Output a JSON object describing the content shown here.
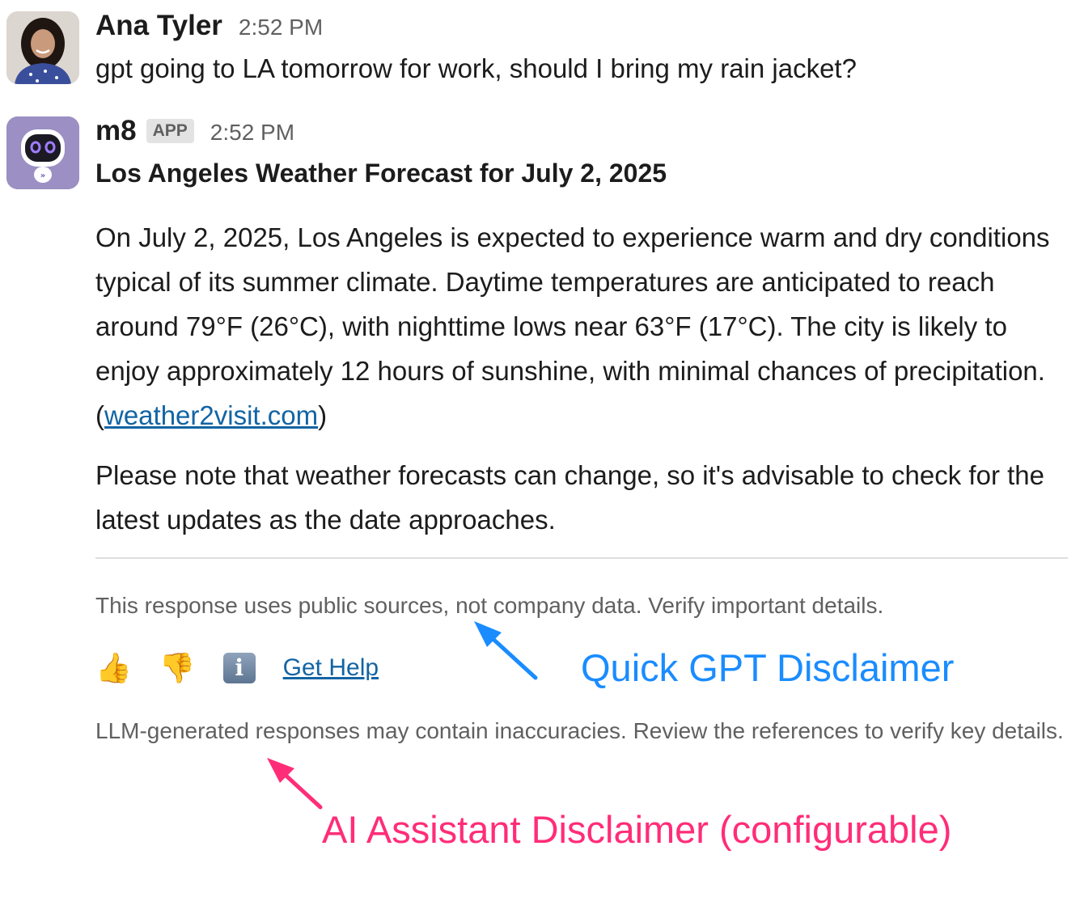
{
  "messages": [
    {
      "sender": "Ana Tyler",
      "time": "2:52 PM",
      "text": "gpt going to LA tomorrow for work, should I bring my rain jacket?",
      "avatar_icon": "user-photo-avatar"
    },
    {
      "sender": "m8",
      "badge": "APP",
      "time": "2:52 PM",
      "avatar_icon": "robot-avatar",
      "title": "Los Angeles Weather Forecast for July 2, 2025",
      "paragraph1": "On July 2, 2025, Los Angeles is expected to experience warm and dry conditions typical of its summer climate. Daytime temperatures are anticipated to reach around 79°F (26°C), with nighttime lows near 63°F (17°C). The city is likely to enjoy approximately 12 hours of sunshine, with minimal chances of precipitation. (",
      "link_text": "weather2visit.com",
      "paragraph1_end": ")",
      "paragraph2": "Please note that weather forecasts can change, so it's advisable to check for the latest updates as the date approaches.",
      "notice": "This response uses public sources, not company data. Verify important details.",
      "actions": {
        "thumbs_up": "👍",
        "thumbs_down": "👎",
        "info": "i",
        "get_help": "Get Help"
      },
      "llm_note": "LLM-generated responses may contain inaccuracies. Review the references to verify key details."
    }
  ],
  "annotations": {
    "quick_gpt": "Quick GPT Disclaimer",
    "ai_assistant": "AI Assistant Disclaimer (configurable)"
  },
  "colors": {
    "link": "#1264a3",
    "annotation_blue": "#1a8cff",
    "annotation_pink": "#ff2d78",
    "bot_avatar_bg": "#9b8fc4"
  }
}
